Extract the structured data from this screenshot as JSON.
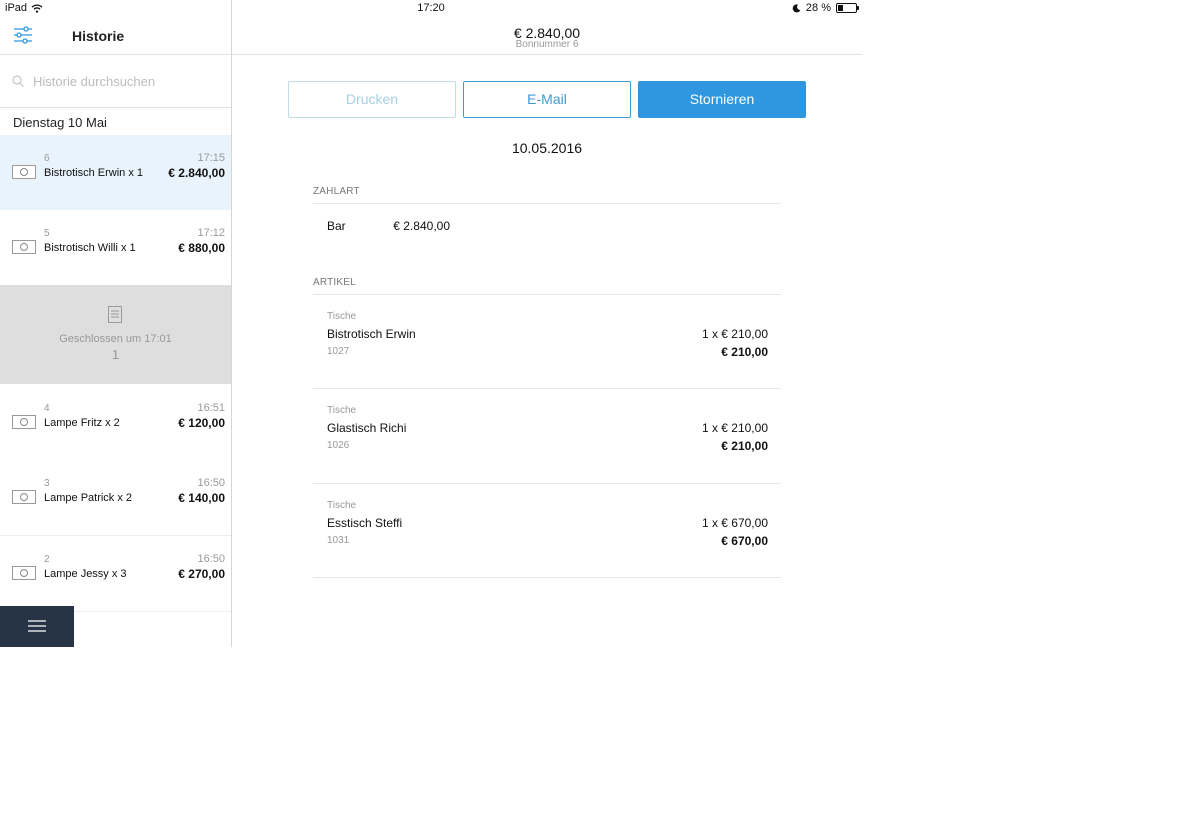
{
  "status_bar": {
    "device": "iPad",
    "time": "17:20",
    "battery": "28 %"
  },
  "sidebar": {
    "title": "Historie",
    "search_placeholder": "Historie durchsuchen",
    "day": "Dienstag 10 Mai",
    "rows": [
      {
        "num": "6",
        "time": "17:15",
        "name": "Bistrotisch Erwin x 1",
        "amount": "€ 2.840,00"
      },
      {
        "num": "5",
        "time": "17:12",
        "name": "Bistrotisch Willi x 1",
        "amount": "€ 880,00"
      },
      {
        "num": "4",
        "time": "16:51",
        "name": "Lampe Fritz x 2",
        "amount": "€ 120,00"
      },
      {
        "num": "3",
        "time": "16:50",
        "name": "Lampe Patrick x 2",
        "amount": "€ 140,00"
      },
      {
        "num": "2",
        "time": "16:50",
        "name": "Lampe Jessy x 3",
        "amount": "€ 270,00"
      }
    ],
    "closed": {
      "label": "Geschlossen um 17:01",
      "count": "1"
    }
  },
  "main": {
    "total": "€ 2.840,00",
    "bon": "Bonnummer 6",
    "buttons": {
      "print": "Drucken",
      "email": "E-Mail",
      "storno": "Stornieren"
    },
    "date": "10.05.2016",
    "payment": {
      "label": "ZAHLART",
      "method": "Bar",
      "amount": "€ 2.840,00"
    },
    "articles_label": "ARTIKEL",
    "articles": [
      {
        "category": "Tische",
        "name": "Bistrotisch Erwin",
        "sku": "1027",
        "qty": "1 x € 210,00",
        "total": "€ 210,00"
      },
      {
        "category": "Tische",
        "name": "Glastisch Richi",
        "sku": "1026",
        "qty": "1 x € 210,00",
        "total": "€ 210,00"
      },
      {
        "category": "Tische",
        "name": "Esstisch Steffi",
        "sku": "1031",
        "qty": "1 x € 670,00",
        "total": "€ 670,00"
      }
    ]
  },
  "colors": {
    "accent": "#2f97df",
    "menu_bg": "#263445",
    "selected_row": "#e9f3fc",
    "closed_bg": "#dedede"
  }
}
